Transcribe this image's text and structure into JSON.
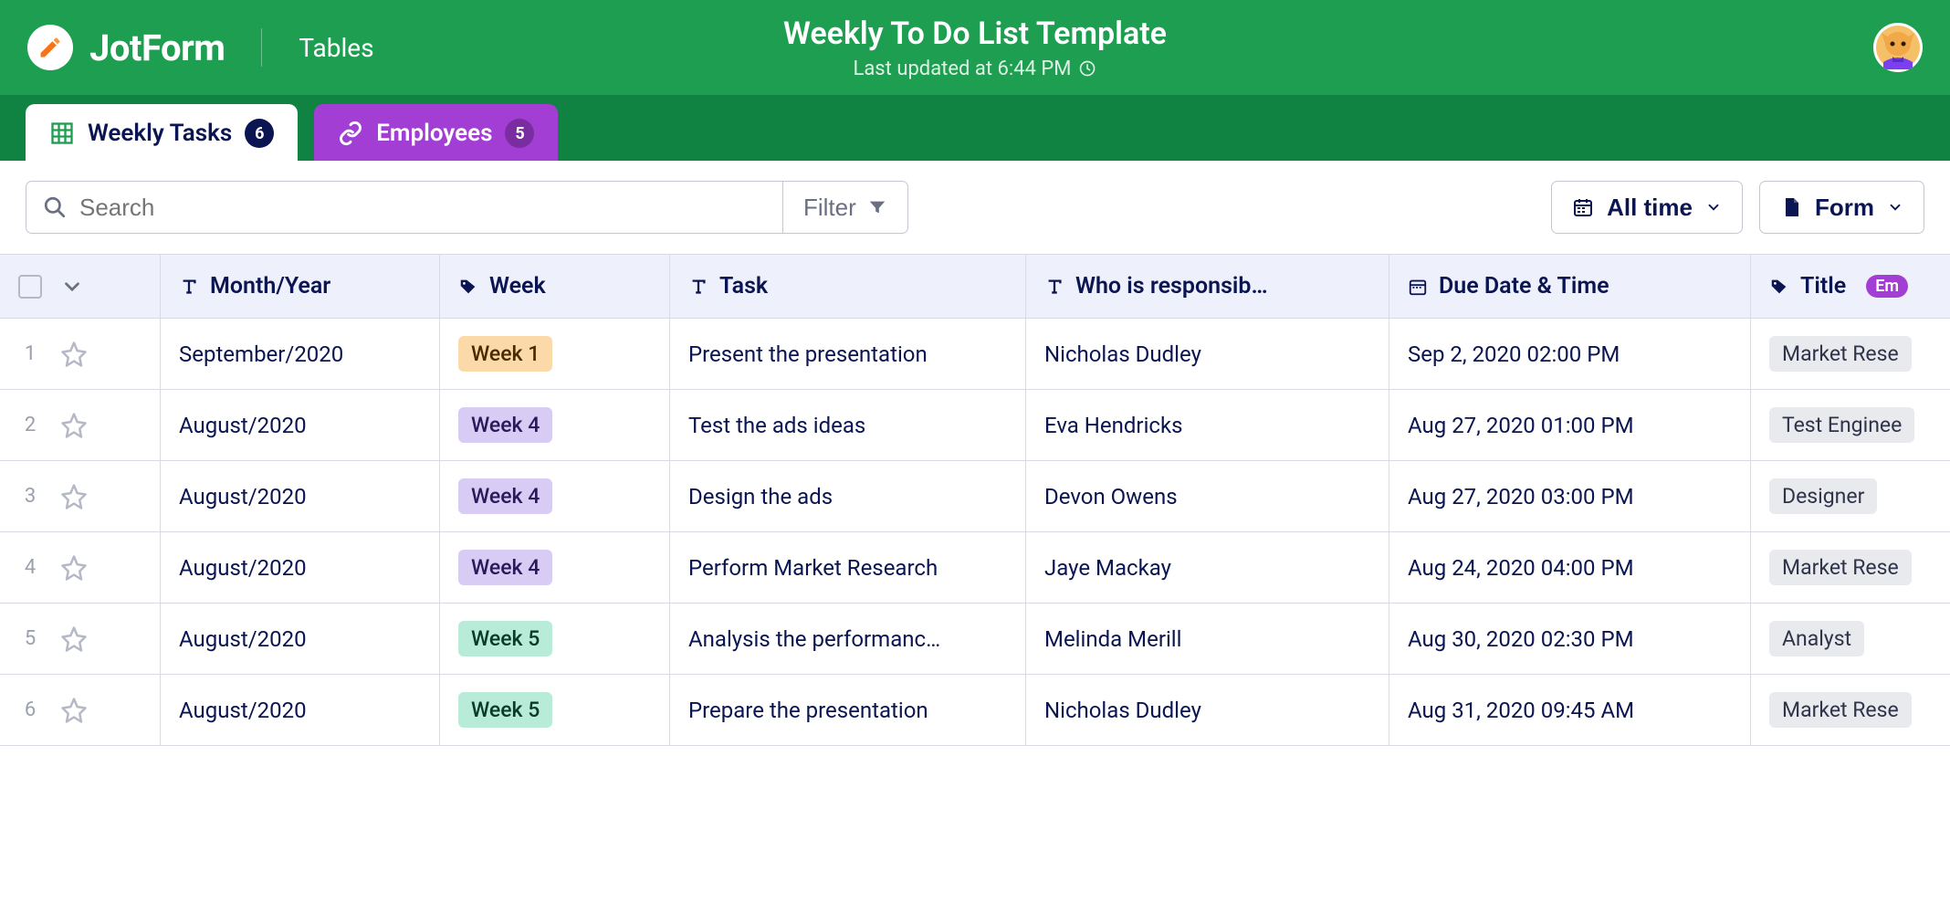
{
  "brand": {
    "name": "JotForm",
    "section": "Tables"
  },
  "page": {
    "title": "Weekly To Do List Template",
    "last_updated": "Last updated at 6:44 PM"
  },
  "tabs": [
    {
      "label": "Weekly Tasks",
      "count": "6"
    },
    {
      "label": "Employees",
      "count": "5"
    }
  ],
  "toolbar": {
    "search_placeholder": "Search",
    "filter_label": "Filter",
    "time_label": "All time",
    "form_label": "Form"
  },
  "columns": {
    "month": "Month/Year",
    "week": "Week",
    "task": "Task",
    "who": "Who is responsib…",
    "due": "Due Date & Time",
    "title": "Title",
    "title_badge": "Em"
  },
  "rows": [
    {
      "n": "1",
      "month": "September/2020",
      "week": "Week 1",
      "week_class": "week-1",
      "task": "Present the presentation",
      "who": "Nicholas Dudley",
      "due": "Sep 2, 2020 02:00 PM",
      "title": "Market Rese"
    },
    {
      "n": "2",
      "month": "August/2020",
      "week": "Week 4",
      "week_class": "week-4",
      "task": "Test the ads ideas",
      "who": "Eva Hendricks",
      "due": "Aug 27, 2020 01:00 PM",
      "title": "Test Enginee"
    },
    {
      "n": "3",
      "month": "August/2020",
      "week": "Week 4",
      "week_class": "week-4",
      "task": "Design the ads",
      "who": "Devon Owens",
      "due": "Aug 27, 2020 03:00 PM",
      "title": "Designer"
    },
    {
      "n": "4",
      "month": "August/2020",
      "week": "Week 4",
      "week_class": "week-4",
      "task": "Perform Market Research",
      "who": "Jaye Mackay",
      "due": "Aug 24, 2020 04:00 PM",
      "title": "Market Rese"
    },
    {
      "n": "5",
      "month": "August/2020",
      "week": "Week 5",
      "week_class": "week-5",
      "task": "Analysis the performanc…",
      "who": "Melinda Merill",
      "due": "Aug 30, 2020 02:30 PM",
      "title": "Analyst"
    },
    {
      "n": "6",
      "month": "August/2020",
      "week": "Week 5",
      "week_class": "week-5",
      "task": "Prepare the presentation",
      "who": "Nicholas Dudley",
      "due": "Aug 31, 2020 09:45 AM",
      "title": "Market Rese"
    }
  ]
}
